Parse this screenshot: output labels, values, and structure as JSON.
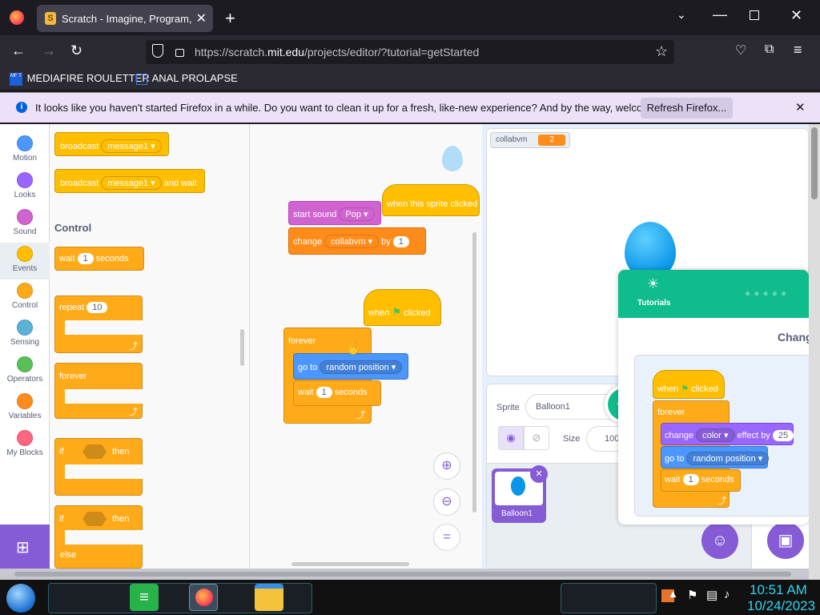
{
  "browser": {
    "tab_title": "Scratch - Imagine, Program, Sh",
    "url_prefix": "https://scratch.",
    "url_domain": "mit.edu",
    "url_path": "/projects/editor/?tutorial=getStarted",
    "bookmarks": [
      "MEDIAFIRE ROULETTER",
      "ANAL PROLAPSE"
    ],
    "bookmark_badge": "MF T"
  },
  "infobar": {
    "message": "It looks like you haven't started Firefox in a while. Do you want to clean it up for a fresh, like-new experience? And by the way, welcome back!",
    "button": "Refresh Firefox..."
  },
  "categories": [
    {
      "label": "Motion",
      "color": "#4c97ff"
    },
    {
      "label": "Looks",
      "color": "#9966ff"
    },
    {
      "label": "Sound",
      "color": "#cf63cf"
    },
    {
      "label": "Events",
      "color": "#ffbf00"
    },
    {
      "label": "Control",
      "color": "#ffab19"
    },
    {
      "label": "Sensing",
      "color": "#5cb1d6"
    },
    {
      "label": "Operators",
      "color": "#59c059"
    },
    {
      "label": "Variables",
      "color": "#ff8c1a"
    },
    {
      "label": "My Blocks",
      "color": "#ff6680"
    }
  ],
  "palette": {
    "broadcast": "broadcast",
    "message1": "message1",
    "and_wait": "and wait",
    "control_heading": "Control",
    "wait": "wait",
    "wait_value": "1",
    "seconds": "seconds",
    "repeat": "repeat",
    "repeat_value": "10",
    "forever": "forever",
    "if": "if",
    "then": "then",
    "else": "else"
  },
  "scripts": {
    "start_sound": "start sound",
    "pop": "Pop",
    "when_sprite_clicked": "when this sprite clicked",
    "change": "change",
    "collabvm": "collabvm",
    "by": "by",
    "by_value": "1",
    "when": "when",
    "clicked": "clicked",
    "forever": "forever",
    "go_to": "go to",
    "random_position": "random position",
    "wait": "wait",
    "wait_value": "1",
    "seconds": "seconds"
  },
  "stage": {
    "monitor_label": "collabvm",
    "monitor_value": "2"
  },
  "sprite_pane": {
    "sprite_label": "Sprite",
    "sprite_name": "Balloon1",
    "size_label": "Size",
    "size_value": "100",
    "thumb_name": "Balloon1"
  },
  "tutorial": {
    "header": "Tutorials",
    "title": "Chang",
    "when": "when",
    "clicked": "clicked",
    "forever": "forever",
    "change": "change",
    "color": "color",
    "effect_by": "effect by",
    "effect_value": "25",
    "go_to": "go to",
    "random_position": "random position",
    "wait": "wait",
    "wait_value": "1",
    "seconds": "seconds"
  },
  "taskbar": {
    "time": "10:51 AM",
    "date": "10/24/2023"
  }
}
